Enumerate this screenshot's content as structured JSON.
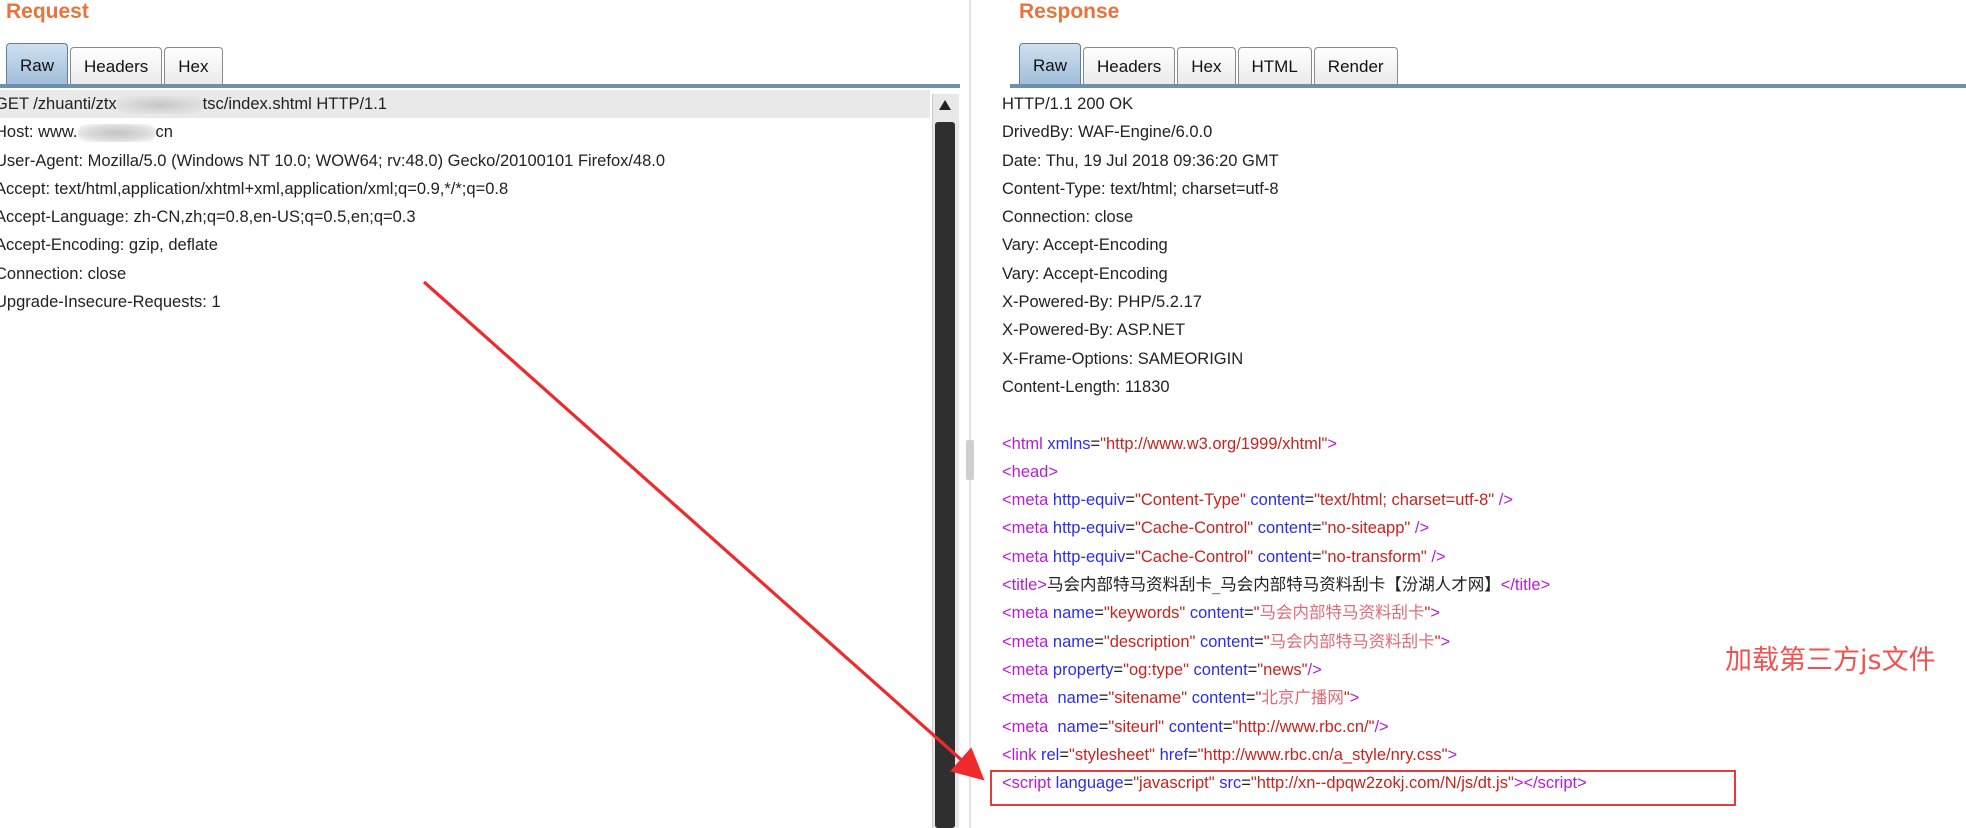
{
  "request": {
    "title": "Request",
    "tabs": [
      "Raw",
      "Headers",
      "Hex"
    ],
    "active_tab": "Raw",
    "lines": {
      "l1a": "GET /zhuanti/ztx",
      "l1b": "tsc/index.shtml HTTP/1.1",
      "l2a": "Host: www.",
      "l2b": "cn",
      "l3": "User-Agent: Mozilla/5.0 (Windows NT 10.0; WOW64; rv:48.0) Gecko/20100101 Firefox/48.0",
      "l4": "Accept: text/html,application/xhtml+xml,application/xml;q=0.9,*/*;q=0.8",
      "l5": "Accept-Language: zh-CN,zh;q=0.8,en-US;q=0.5,en;q=0.3",
      "l6": "Accept-Encoding: gzip, deflate",
      "l7": "Connection: close",
      "l8": "Upgrade-Insecure-Requests: 1"
    }
  },
  "response": {
    "title": "Response",
    "tabs": [
      "Raw",
      "Headers",
      "Hex",
      "HTML",
      "Render"
    ],
    "active_tab": "Raw",
    "headers": [
      "HTTP/1.1 200 OK",
      "DrivedBy: WAF-Engine/6.0.0",
      "Date: Thu, 19 Jul 2018 09:36:20 GMT",
      "Content-Type: text/html; charset=utf-8",
      "Connection: close",
      "Vary: Accept-Encoding",
      "Vary: Accept-Encoding",
      "X-Powered-By: PHP/5.2.17",
      "X-Powered-By: ASP.NET",
      "X-Frame-Options: SAMEORIGIN",
      "Content-Length: 11830"
    ],
    "html_body": {
      "html_open": {
        "tag": "html",
        "attr": "xmlns",
        "value": "\"http://www.w3.org/1999/xhtml\""
      },
      "head_open": "head",
      "meta1": {
        "attr1": "http-equiv",
        "val1": "\"Content-Type\"",
        "attr2": "content",
        "val2": "\"text/html; charset=utf-8\""
      },
      "meta2": {
        "attr1": "http-equiv",
        "val1": "\"Cache-Control\"",
        "attr2": "content",
        "val2": "\"no-siteapp\""
      },
      "meta3": {
        "attr1": "http-equiv",
        "val1": "\"Cache-Control\"",
        "attr2": "content",
        "val2": "\"no-transform\""
      },
      "title_text": "马会内部特马资料刮卡_马会内部特马资料刮卡【汾湖人才网】",
      "meta4": {
        "attr1": "name",
        "val1": "\"keywords\"",
        "attr2": "content",
        "val2": "马会内部特马资料刮卡"
      },
      "meta5": {
        "attr1": "name",
        "val1": "\"description\"",
        "attr2": "content",
        "val2": "马会内部特马资料刮卡"
      },
      "meta6": {
        "attr1": "property",
        "val1": "\"og:type\"",
        "attr2": "content",
        "val2": "\"news\""
      },
      "meta7": {
        "attr1": "name",
        "val1": "\"sitename\"",
        "attr2": "content",
        "val2": "北京广播网"
      },
      "meta8": {
        "attr1": "name",
        "val1": "\"siteurl\"",
        "attr2": "content",
        "val2": "\"http://www.rbc.cn/\""
      },
      "link": {
        "attr1": "rel",
        "val1": "\"stylesheet\"",
        "attr2": "href",
        "val2": "\"http://www.rbc.cn/a_style/nry.css\""
      },
      "script": {
        "attr1": "language",
        "val1": "\"javascript\"",
        "attr2": "src",
        "val2": "\"http://xn--dpqw2zokj.com/N/js/dt.js\""
      }
    }
  },
  "annotation": "加载第三方js文件",
  "colors": {
    "arrow": "#ef2a2a",
    "highlight_box": "#e73b3b",
    "annotation": "#ef5350",
    "panel_title": "#e8733c"
  }
}
